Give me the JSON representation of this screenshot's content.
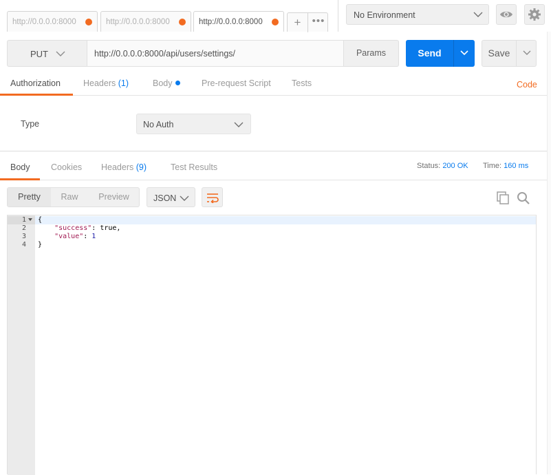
{
  "tabs": [
    {
      "title": "http://0.0.0.0:8000",
      "unsaved": true
    },
    {
      "title": "http://0.0.0.0:8000",
      "unsaved": true
    },
    {
      "title": "http://0.0.0.0:8000",
      "unsaved": true
    }
  ],
  "tab_actions": {
    "add": "+",
    "more": "•••"
  },
  "environment": {
    "selected": "No Environment"
  },
  "request": {
    "method": "PUT",
    "url": "http://0.0.0.0:8000/api/users/settings/",
    "params_label": "Params",
    "send_label": "Send",
    "save_label": "Save"
  },
  "request_tabs": {
    "authorization": "Authorization",
    "headers": "Headers",
    "headers_count": "(1)",
    "body": "Body",
    "prerequest": "Pre-request Script",
    "tests": "Tests",
    "code": "Code"
  },
  "auth": {
    "type_label": "Type",
    "type_value": "No Auth"
  },
  "response_tabs": {
    "body": "Body",
    "cookies": "Cookies",
    "headers": "Headers",
    "headers_count": "(9)",
    "test_results": "Test Results"
  },
  "response_meta": {
    "status_label": "Status:",
    "status_value": "200 OK",
    "time_label": "Time:",
    "time_value": "160 ms"
  },
  "view_modes": {
    "pretty": "Pretty",
    "raw": "Raw",
    "preview": "Preview",
    "active": "Pretty"
  },
  "format": {
    "selected": "JSON"
  },
  "editor": {
    "line_numbers": [
      "1",
      "2",
      "3",
      "4"
    ],
    "lines": [
      {
        "open": "{"
      },
      {
        "indent": "    ",
        "key": "\"success\"",
        "sep": ": ",
        "value": "true",
        "tail": ","
      },
      {
        "indent": "    ",
        "key": "\"value\"",
        "sep": ": ",
        "value": "1",
        "tail": ""
      },
      {
        "close": "}"
      }
    ]
  },
  "colors": {
    "accent": "#f26b21",
    "primary": "#097bed",
    "json_key": "#a11a52",
    "json_number": "#1a1aa6"
  }
}
